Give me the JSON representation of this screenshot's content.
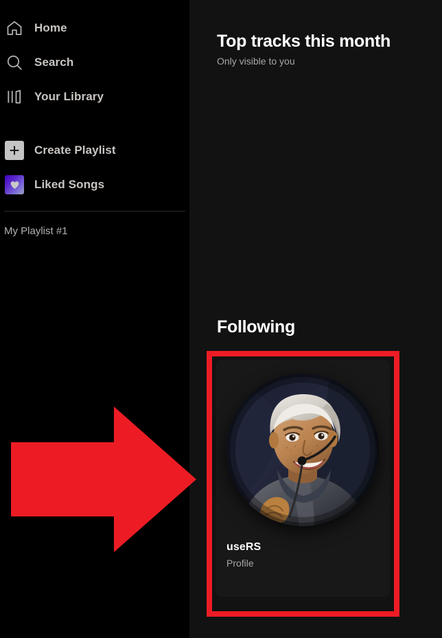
{
  "theme": {
    "sidebar_bg": "#000000",
    "main_bg": "#121212",
    "card_bg": "#181818",
    "text_primary": "#ffffff",
    "text_secondary": "#a7a7a7",
    "sidebar_label": "#c9c5c2",
    "annotation_red": "#ed1c24",
    "liked_gradient_start": "#4300c0",
    "liked_gradient_end": "#9aa7c4",
    "create_tile_bg": "#c4c4c4"
  },
  "sidebar": {
    "primary_nav": [
      {
        "label": "Home",
        "icon": "home-icon"
      },
      {
        "label": "Search",
        "icon": "search-icon"
      },
      {
        "label": "Your Library",
        "icon": "library-icon"
      }
    ],
    "secondary_nav": [
      {
        "label": "Create Playlist",
        "icon": "plus-icon"
      },
      {
        "label": "Liked Songs",
        "icon": "heart-icon"
      }
    ],
    "playlists": [
      {
        "label": "My Playlist #1"
      }
    ]
  },
  "main": {
    "top_tracks": {
      "title": "Top tracks this month",
      "subtitle": "Only visible to you"
    },
    "following": {
      "title": "Following",
      "cards": [
        {
          "name": "useRS",
          "type": "Profile",
          "avatar": "user-photo-headset"
        }
      ]
    }
  },
  "annotations": {
    "arrow": {
      "name": "red-right-arrow",
      "color": "#ed1c24",
      "direction": "right"
    },
    "highlight": {
      "name": "red-highlight-box",
      "color": "#ed1c24",
      "target": "useRS profile card"
    }
  }
}
